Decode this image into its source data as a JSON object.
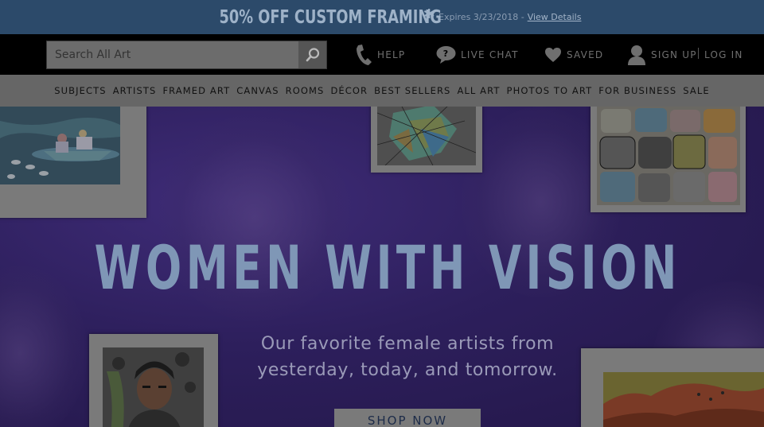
{
  "promo": {
    "headline": "50% OFF CUSTOM FRAMING",
    "asterisk": "*",
    "expires": "Expires 3/23/2018 -",
    "link": "View Details"
  },
  "header": {
    "search_placeholder": "Search All Art",
    "help": "HELP",
    "live_chat": "LIVE CHAT",
    "saved": "SAVED",
    "sign_up": "SIGN UP",
    "log_in": "LOG IN"
  },
  "nav": [
    "SUBJECTS",
    "ARTISTS",
    "FRAMED ART",
    "CANVAS",
    "ROOMS",
    "DÉCOR",
    "BEST SELLERS",
    "ALL ART",
    "PHOTOS TO ART",
    "FOR BUSINESS",
    "SALE"
  ],
  "hero": {
    "title": "WOMEN WITH VISION",
    "subtitle_line1": "Our favorite female artists from",
    "subtitle_line2": "yesterday, today, and tomorrow.",
    "cta": "SHOP NOW"
  },
  "colors": {
    "promo_bg": "#2c4a6a",
    "header_bg": "#000000",
    "nav_bg": "#666666",
    "hero_bg": "#2d1f5c",
    "title": "#7f97b6"
  },
  "icons": [
    "search-icon",
    "phone-icon",
    "chat-bubble-icon",
    "heart-icon",
    "user-icon"
  ]
}
